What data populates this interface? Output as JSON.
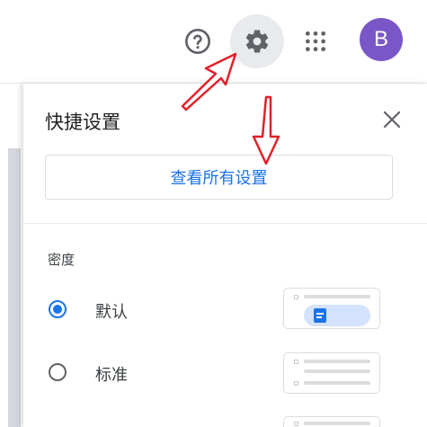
{
  "header": {
    "help_icon": "help-circle-icon",
    "settings_icon": "gear-icon",
    "apps_icon": "apps-grid-icon",
    "avatar_initial": "B",
    "avatar_color": "#7a57c7"
  },
  "quick_settings": {
    "title": "快捷设置",
    "close_icon": "close-icon",
    "all_settings_label": "查看所有设置",
    "density": {
      "label": "密度",
      "options": [
        {
          "label": "默认",
          "selected": true
        },
        {
          "label": "标准",
          "selected": false
        },
        {
          "label": "",
          "selected": false
        }
      ]
    }
  },
  "colors": {
    "accent": "#1a73e8",
    "annotation_red": "#e0202a",
    "settings_highlight": "#e8eaed"
  }
}
